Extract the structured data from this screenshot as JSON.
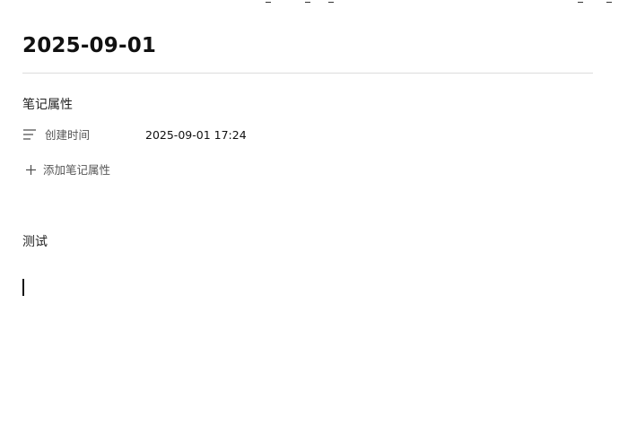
{
  "note": {
    "title": "2025-09-01",
    "properties_heading": "笔记属性",
    "properties": [
      {
        "icon": "text-lines-icon",
        "label": "创建时间",
        "value": "2025-09-01 17:24"
      }
    ],
    "add_property_label": "添加笔记属性",
    "body_text": "测试"
  }
}
